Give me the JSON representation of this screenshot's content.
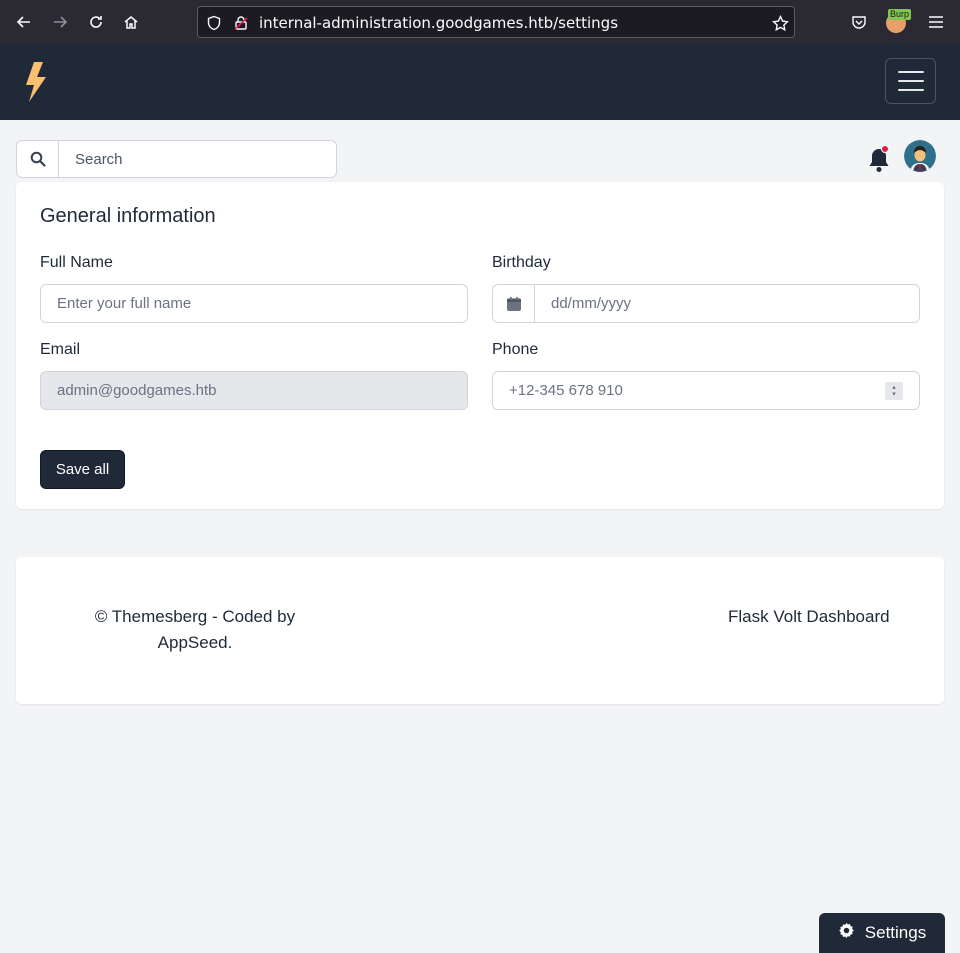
{
  "browser": {
    "url": "internal-administration.goodgames.htb/settings",
    "extension_badge": "Burp"
  },
  "search": {
    "placeholder": "Search"
  },
  "card": {
    "title": "General information",
    "full_name": {
      "label": "Full Name",
      "placeholder": "Enter your full name"
    },
    "birthday": {
      "label": "Birthday",
      "placeholder": "dd/mm/yyyy"
    },
    "email": {
      "label": "Email",
      "placeholder": "admin@goodgames.htb"
    },
    "phone": {
      "label": "Phone",
      "placeholder": "+12-345 678 910"
    },
    "save_label": "Save all"
  },
  "footer": {
    "credit": "© Themesberg - Coded by AppSeed.",
    "product": "Flask Volt Dashboard"
  },
  "settings_label": "Settings",
  "colors": {
    "navbar": "#1f2937",
    "accent_logo": "#fbbf70",
    "notification_dot": "#e11d48"
  }
}
